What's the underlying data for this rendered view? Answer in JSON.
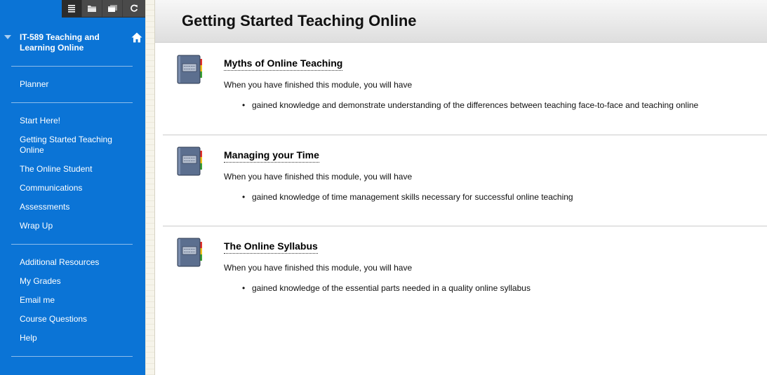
{
  "toolbar": {
    "buttons": [
      {
        "icon": "list-view-icon",
        "label": "Menu view"
      },
      {
        "icon": "folder-view-icon",
        "label": "Folder view"
      },
      {
        "icon": "new-window-icon",
        "label": "Open in new window"
      },
      {
        "icon": "refresh-icon",
        "label": "Refresh"
      }
    ]
  },
  "sidebar": {
    "course_title": "IT-589 Teaching and Learning Online",
    "home_icon": "home-icon",
    "groups": [
      [
        "Planner"
      ],
      [
        "Start Here!",
        "Getting Started Teaching Online",
        "The Online Student",
        "Communications",
        "Assessments",
        "Wrap Up"
      ],
      [
        "Additional Resources",
        "My Grades",
        "Email me",
        "Course Questions",
        "Help"
      ]
    ]
  },
  "page": {
    "title": "Getting Started Teaching Online"
  },
  "modules": [
    {
      "title": "Myths of Online Teaching",
      "intro": "When you have finished this module, you will have",
      "bullets": [
        "gained knowledge and demonstrate understanding of the differences between teaching face-to-face and teaching online"
      ],
      "icon": "learning-module-icon"
    },
    {
      "title": "Managing your Time",
      "intro": "When you have finished this module, you will have",
      "bullets": [
        "gained knowledge of time management skills necessary for successful online teaching"
      ],
      "icon": "learning-module-icon"
    },
    {
      "title": "The Online Syllabus",
      "intro": "When you have finished this module, you will have",
      "bullets": [
        "gained knowledge of the essential parts needed in a quality online syllabus"
      ],
      "icon": "learning-module-icon"
    }
  ],
  "colors": {
    "sidebar_bg": "#0b74d6",
    "toolbar_bg": "#4a4a4a",
    "divider": "#8dbcea"
  }
}
